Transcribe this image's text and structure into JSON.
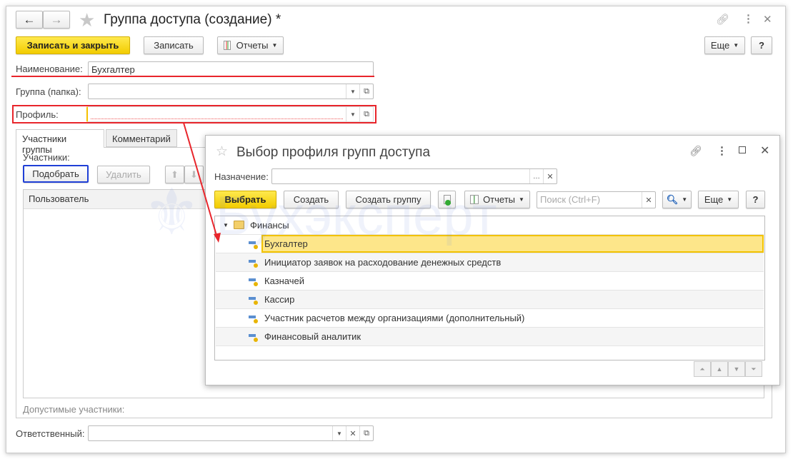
{
  "window": {
    "title": "Группа доступа (создание) *",
    "back_icon": "←",
    "forward_icon": "→"
  },
  "toolbar": {
    "save_close": "Записать и закрыть",
    "save": "Записать",
    "reports": "Отчеты",
    "more": "Еще",
    "help": "?"
  },
  "form": {
    "name_label": "Наименование:",
    "name_value": "Бухгалтер",
    "group_label": "Группа (папка):",
    "group_value": "",
    "profile_label": "Профиль:",
    "profile_value": "",
    "responsible_label": "Ответственный:",
    "responsible_value": ""
  },
  "tabs": [
    {
      "label": "Участники группы"
    },
    {
      "label": "Комментарий"
    }
  ],
  "members": {
    "label": "Участники:",
    "pick": "Подобрать",
    "delete": "Удалить",
    "column_user": "Пользователь",
    "allowed_label": "Допустимые участники:"
  },
  "dialog": {
    "title": "Выбор профиля групп доступа",
    "purpose_label": "Назначение:",
    "purpose_value": "",
    "select": "Выбрать",
    "create": "Создать",
    "create_group": "Создать группу",
    "reports": "Отчеты",
    "search_placeholder": "Поиск (Ctrl+F)",
    "more": "Еще",
    "help": "?",
    "tree_group": "Финансы",
    "items": [
      {
        "label": "Бухгалтер",
        "selected": true
      },
      {
        "label": "Инициатор заявок на расходование денежных средств"
      },
      {
        "label": "Казначей"
      },
      {
        "label": "Кассир"
      },
      {
        "label": "Участник расчетов между организациями (дополнительный)"
      },
      {
        "label": "Финансовый аналитик"
      }
    ]
  },
  "watermark": "Бухэксперт",
  "colors": {
    "accent_yellow": "#f5d000",
    "annotation_red": "#e8252b",
    "annotation_blue": "#1f3fd6",
    "selected_row": "#fde68a"
  }
}
